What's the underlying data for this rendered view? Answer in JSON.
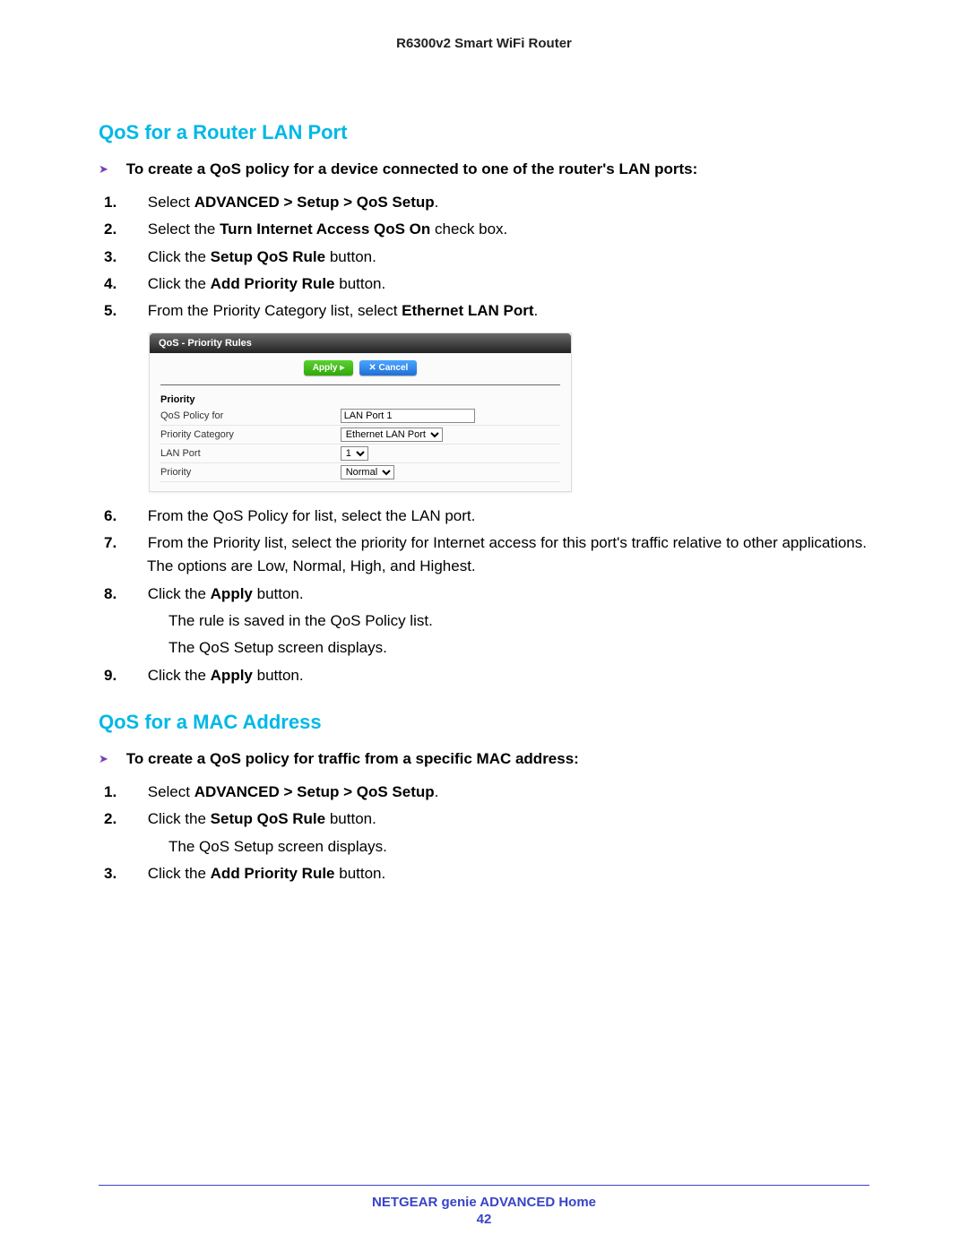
{
  "header": {
    "title": "R6300v2 Smart WiFi Router"
  },
  "section1": {
    "heading": "QoS for a Router LAN Port",
    "intro": "To create a QoS policy for a device connected to one of the router's LAN ports:",
    "s1_pre": "Select ",
    "s1_bold": "ADVANCED > Setup > QoS Setup",
    "s1_post": ".",
    "s2_pre": "Select the ",
    "s2_bold": "Turn Internet Access QoS On",
    "s2_post": " check box.",
    "s3_pre": "Click the ",
    "s3_bold": "Setup QoS Rule",
    "s3_post": " button.",
    "s4_pre": "Click the ",
    "s4_bold": "Add Priority Rule",
    "s4_post": " button.",
    "s5_pre": "From the Priority Category list, select ",
    "s5_bold": "Ethernet LAN Port",
    "s5_post": ".",
    "s6": "From the QoS Policy for list, select the LAN port.",
    "s7": "From the Priority list, select the priority for Internet access for this port's traffic relative to other applications. The options are Low, Normal, High, and Highest.",
    "s8_pre": "Click the ",
    "s8_bold": "Apply",
    "s8_post": " button.",
    "s8_sub1": "The rule is saved in the QoS Policy list.",
    "s8_sub2": "The QoS Setup screen displays.",
    "s9_pre": "Click the ",
    "s9_bold": "Apply",
    "s9_post": " button."
  },
  "panel": {
    "title": "QoS - Priority Rules",
    "apply": "Apply ▸",
    "cancel": "✕ Cancel",
    "priority_heading": "Priority",
    "row_policy_label": "QoS Policy for",
    "row_policy_value": "LAN Port 1",
    "row_category_label": "Priority Category",
    "row_category_value": "Ethernet LAN Port",
    "row_lanport_label": "LAN Port",
    "row_lanport_value": "1",
    "row_priority_label": "Priority",
    "row_priority_value": "Normal"
  },
  "section2": {
    "heading": "QoS for a MAC Address",
    "intro": "To create a QoS policy for traffic from a specific MAC address:",
    "s1_pre": "Select ",
    "s1_bold": "ADVANCED > Setup > QoS Setup",
    "s1_post": ".",
    "s2_pre": "Click the ",
    "s2_bold": "Setup QoS Rule",
    "s2_post": " button.",
    "s2_sub": "The QoS Setup screen displays.",
    "s3_pre": "Click the ",
    "s3_bold": "Add Priority Rule",
    "s3_post": " button."
  },
  "footer": {
    "title": "NETGEAR genie ADVANCED Home",
    "page": "42"
  }
}
